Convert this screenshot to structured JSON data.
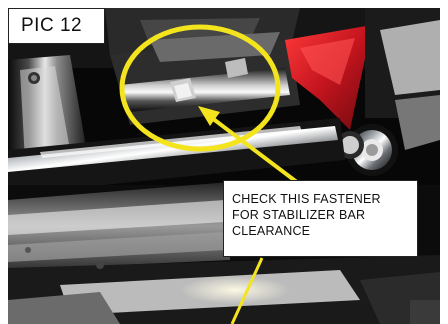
{
  "pic_label": "PIC 12",
  "callout": {
    "lines": [
      "CHECK THIS FASTENER",
      "FOR STABILIZER BAR",
      "CLEARANCE"
    ]
  },
  "colors": {
    "highlight": "#f4e41e",
    "accent_red": "#c4141e",
    "background": "#050505"
  },
  "icons": {
    "pointer_arrow": "arrow-icon",
    "highlight_ring": "ellipse-highlight"
  }
}
